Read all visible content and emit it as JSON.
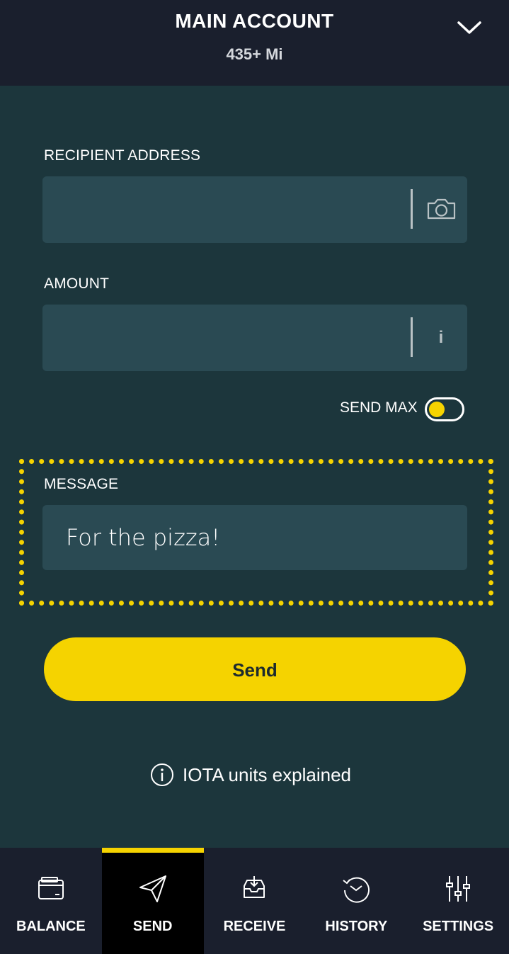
{
  "header": {
    "account_name": "MAIN ACCOUNT",
    "balance": "435+ Mi"
  },
  "form": {
    "recipient_label": "RECIPIENT ADDRESS",
    "recipient_value": "",
    "amount_label": "AMOUNT",
    "amount_value": "",
    "amount_info": "i",
    "send_max_label": "SEND MAX",
    "send_max_enabled": false,
    "message_label": "MESSAGE",
    "message_value": "For the pizza!",
    "send_button": "Send",
    "units_link": "IOTA units explained"
  },
  "nav": {
    "items": [
      {
        "label": "BALANCE",
        "icon": "wallet-icon"
      },
      {
        "label": "SEND",
        "icon": "paper-plane-icon"
      },
      {
        "label": "RECEIVE",
        "icon": "inbox-icon"
      },
      {
        "label": "HISTORY",
        "icon": "history-icon"
      },
      {
        "label": "SETTINGS",
        "icon": "sliders-icon"
      }
    ],
    "active": "SEND"
  },
  "colors": {
    "background": "#1c363c",
    "header_bg": "#1a1f2d",
    "field_bg": "#2a4a53",
    "accent": "#f5d300"
  }
}
